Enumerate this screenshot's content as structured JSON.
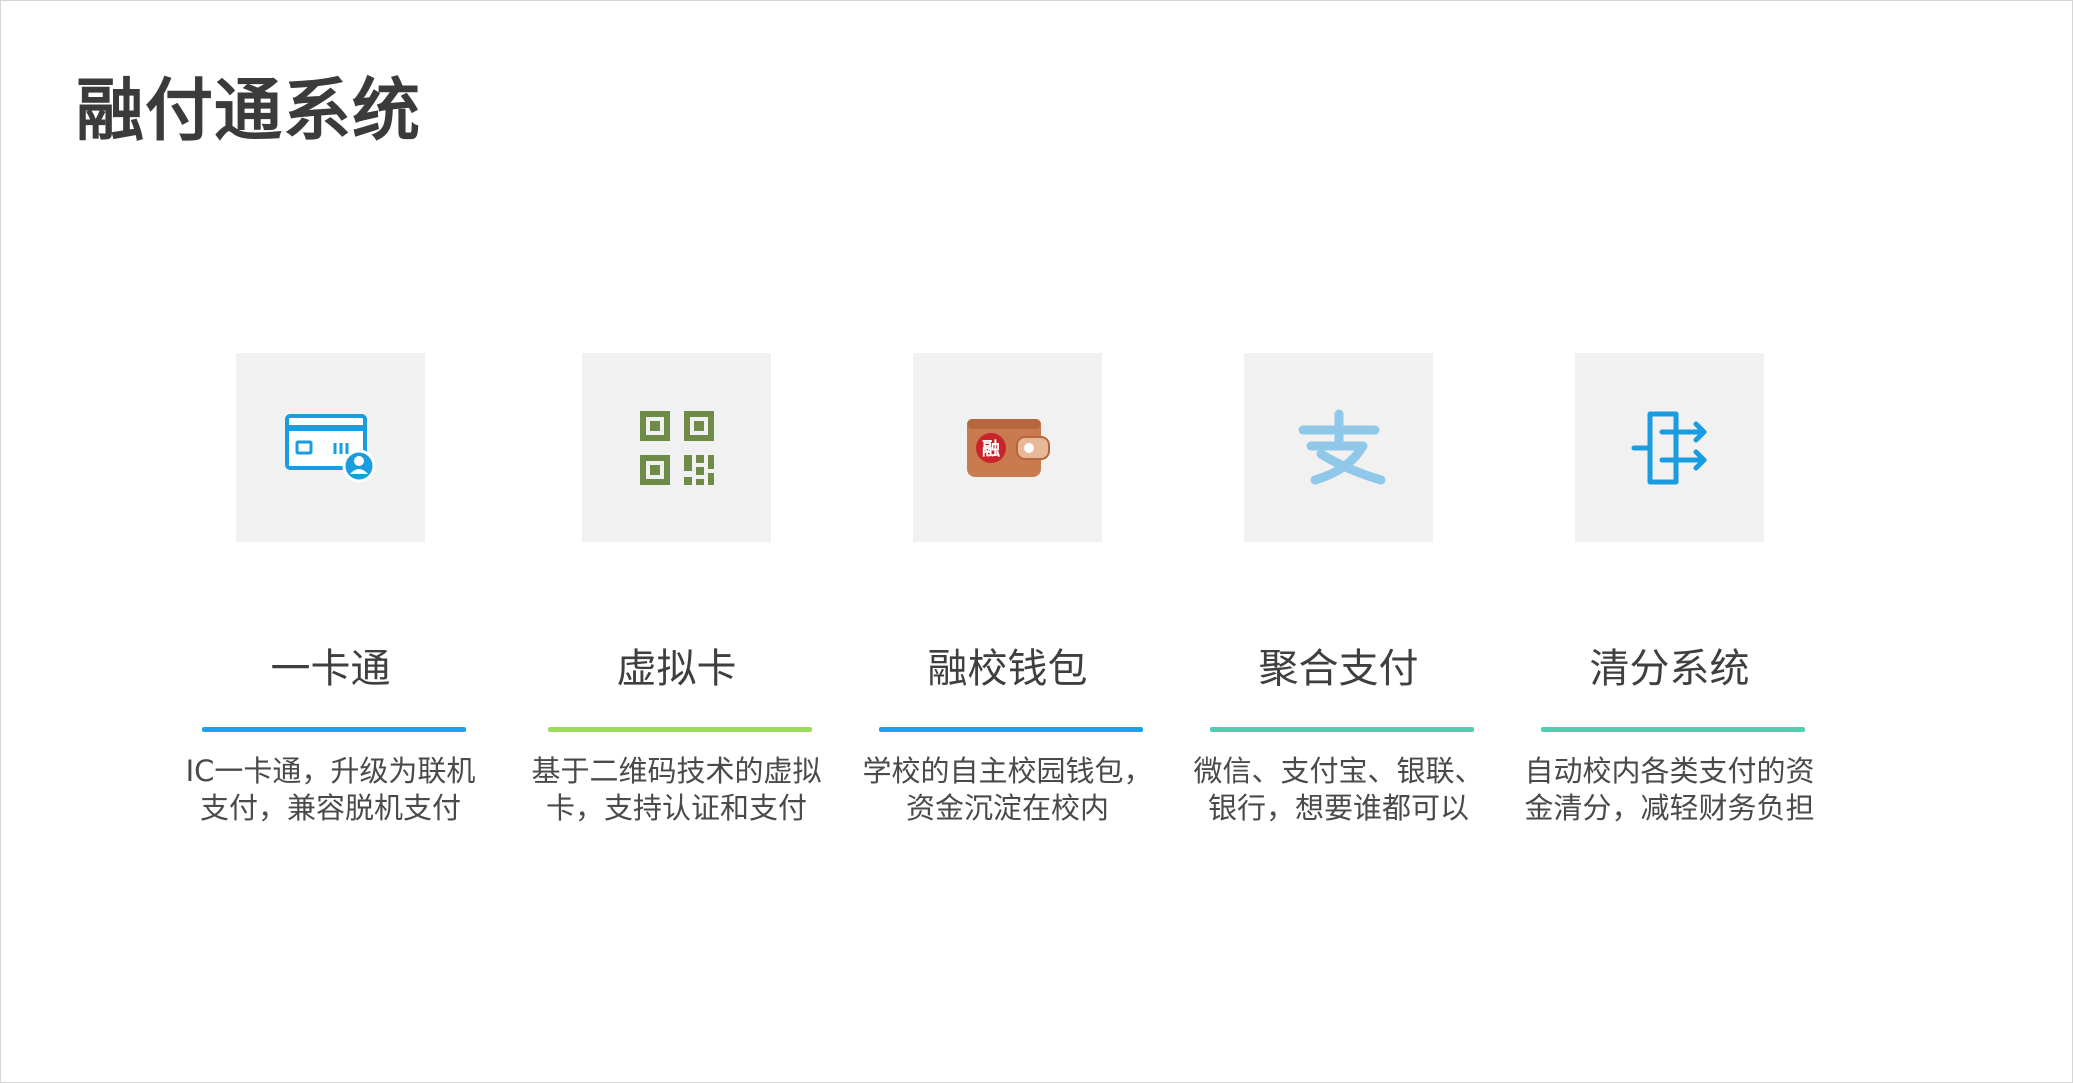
{
  "slide": {
    "title": "融付通系统"
  },
  "features": [
    {
      "title": "一卡通",
      "desc_line1": "IC一卡通，升级为联机",
      "desc_line2": "支付，兼容脱机支付",
      "icon": "card-user-icon",
      "accent": "#1aa3e8"
    },
    {
      "title": "虚拟卡",
      "desc_line1": "基于二维码技术的虚拟",
      "desc_line2": "卡，支持认证和支付",
      "icon": "qr-code-icon",
      "accent": "#9ddc5a"
    },
    {
      "title": "融校钱包",
      "desc_line1": "学校的自主校园钱包，",
      "desc_line2": "资金沉淀在校内",
      "icon": "wallet-icon",
      "accent": "#1aa3e8",
      "icon_glyph": "融"
    },
    {
      "title": "聚合支付",
      "desc_line1": "微信、支付宝、银联、",
      "desc_line2": "银行，想要谁都可以",
      "icon": "alipay-icon",
      "accent": "#4fcfb0",
      "icon_glyph": "支"
    },
    {
      "title": "清分系统",
      "desc_line1": "自动校内各类支付的资",
      "desc_line2": "金清分，减轻财务负担",
      "icon": "split-arrows-icon",
      "accent": "#4fcfb0"
    }
  ]
}
